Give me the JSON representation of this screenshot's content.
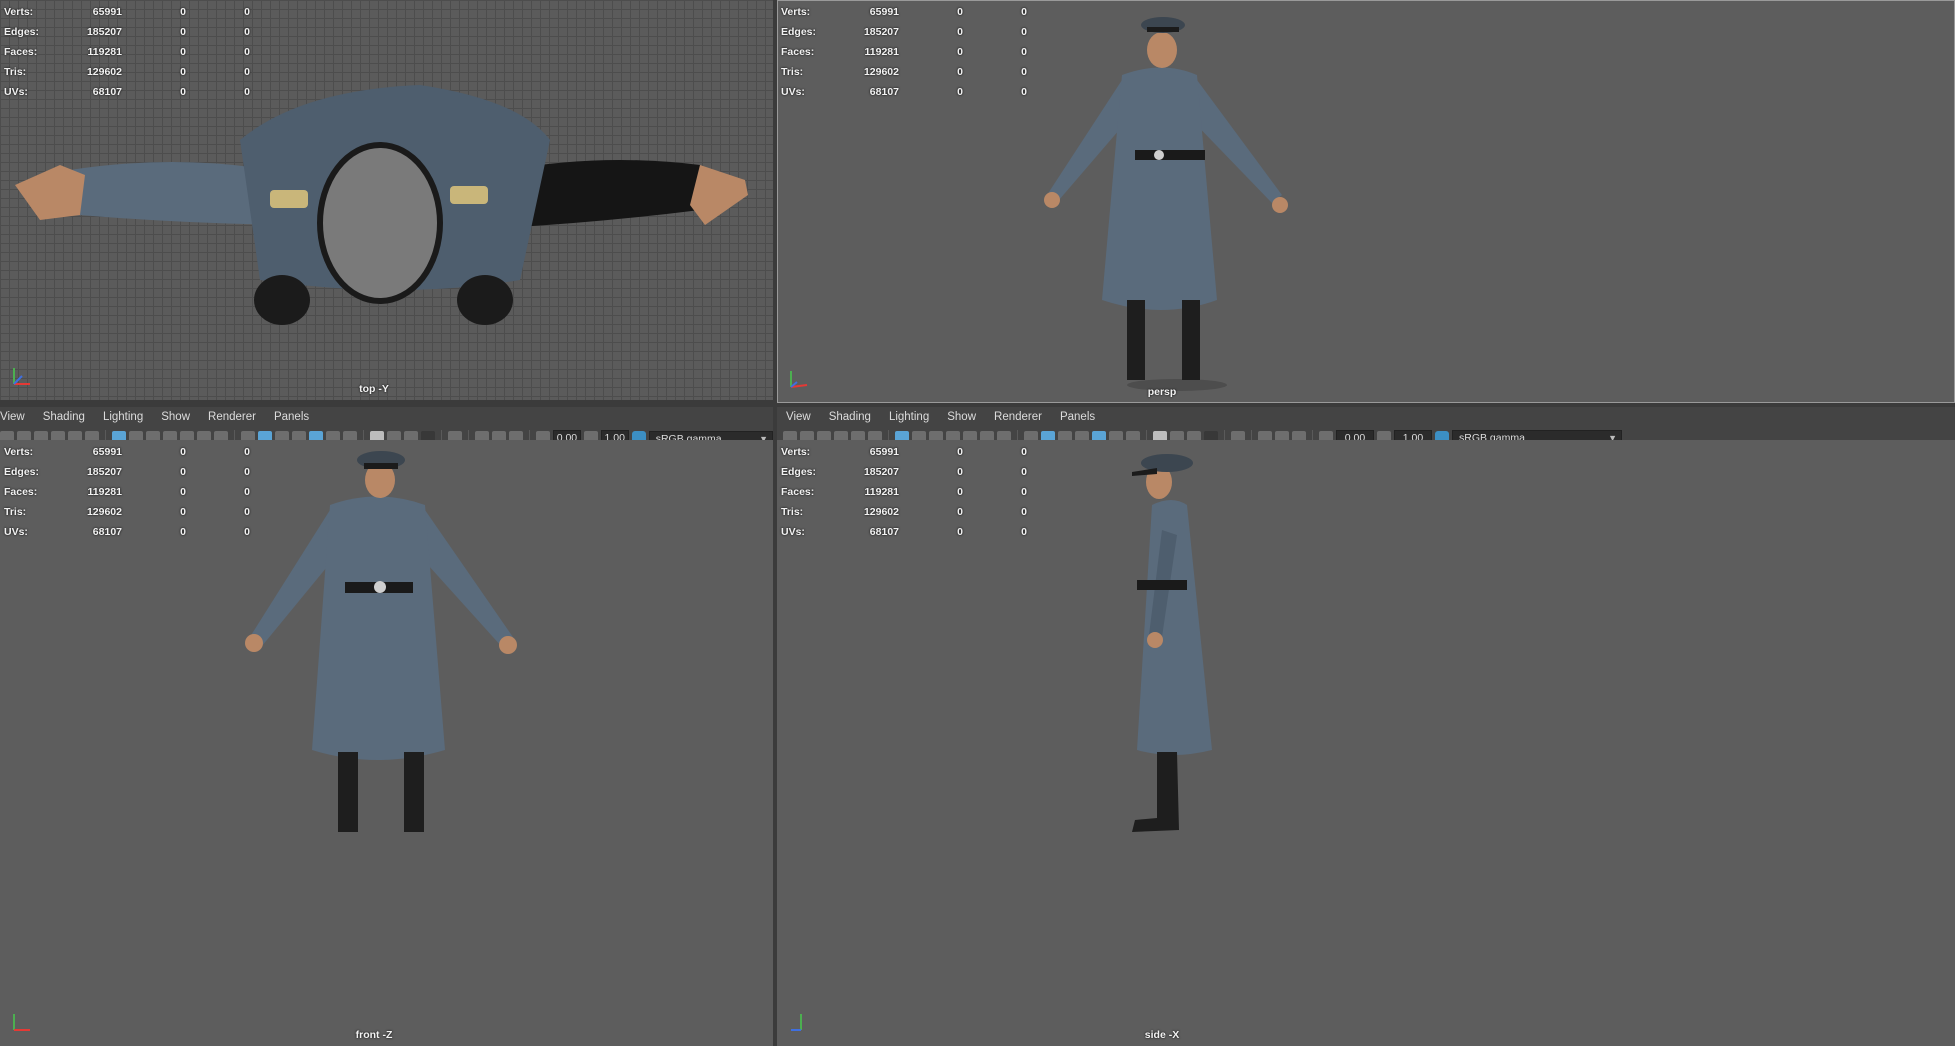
{
  "stats": {
    "rows": [
      {
        "label": "Verts:",
        "value": "65991",
        "sel": "0",
        "tri": "0"
      },
      {
        "label": "Edges:",
        "value": "185207",
        "sel": "0",
        "tri": "0"
      },
      {
        "label": "Faces:",
        "value": "119281",
        "sel": "0",
        "tri": "0"
      },
      {
        "label": "Tris:",
        "value": "129602",
        "sel": "0",
        "tri": "0"
      },
      {
        "label": "UVs:",
        "value": "68107",
        "sel": "0",
        "tri": "0"
      }
    ]
  },
  "viewports": {
    "top": {
      "camera": "top -Y"
    },
    "persp": {
      "camera": "persp"
    },
    "front": {
      "camera": "front -Z"
    },
    "side": {
      "camera": "side -X"
    }
  },
  "menu": {
    "view": "View",
    "shading": "Shading",
    "lighting": "Lighting",
    "show": "Show",
    "renderer": "Renderer",
    "panels": "Panels"
  },
  "toolbar": {
    "exposure": "0.00",
    "gamma": "1.00",
    "color_space": "sRGB gamma"
  },
  "colors": {
    "viewport_bg": "#5d5d5d",
    "coat": "#5a6b7c",
    "boots": "#1e1e1e",
    "skin": "#b98866",
    "accent": "#5aa4d6"
  }
}
